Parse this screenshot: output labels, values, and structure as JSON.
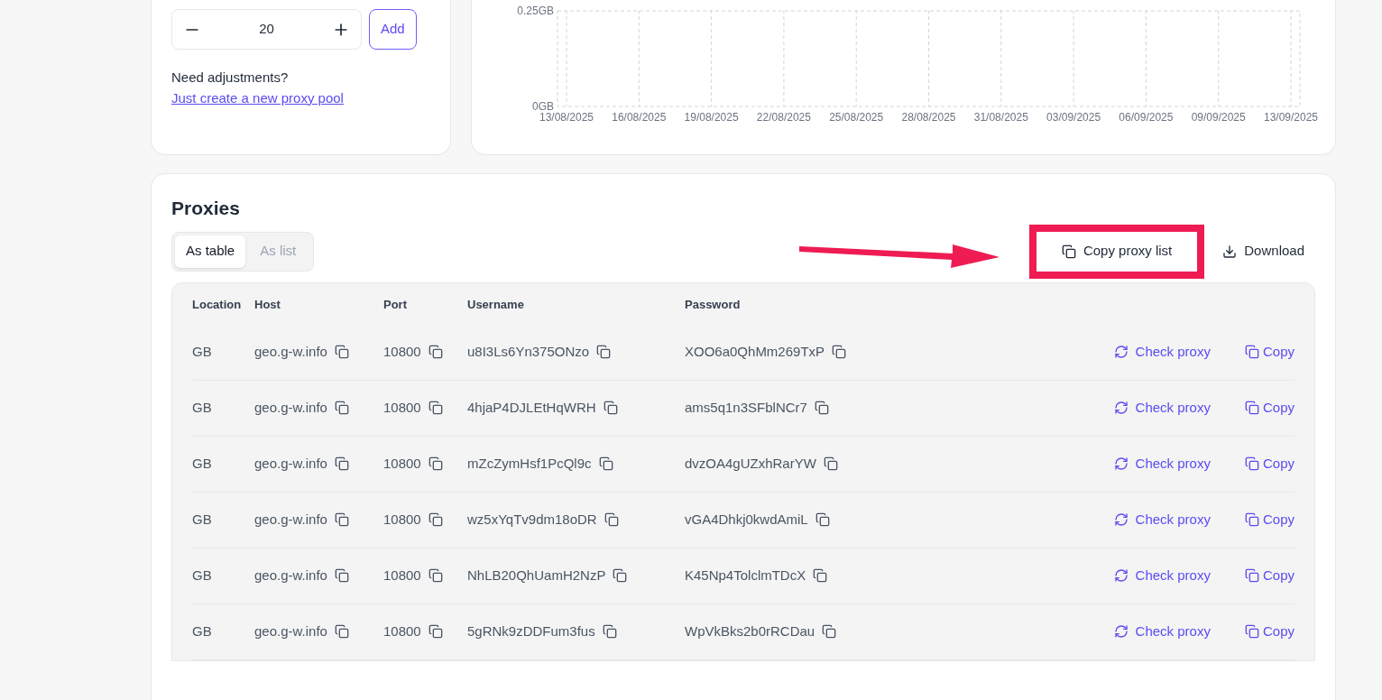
{
  "pool": {
    "quantity": "20",
    "add_button": "Add",
    "question": "Need adjustments?",
    "link": "Just create a new proxy pool"
  },
  "usage_chart": {
    "chart_data": {
      "type": "line",
      "categories": [
        "13/08/2025",
        "16/08/2025",
        "19/08/2025",
        "22/08/2025",
        "25/08/2025",
        "28/08/2025",
        "31/08/2025",
        "03/09/2025",
        "06/09/2025",
        "09/09/2025",
        "13/09/2025"
      ],
      "ylim": [
        0,
        0.25
      ],
      "grid": true,
      "yticks": [
        {
          "value": 0,
          "label": "0GB"
        },
        {
          "value": 0.25,
          "label": "0.25GB"
        }
      ]
    }
  },
  "proxies": {
    "title": "Proxies",
    "tabs": [
      {
        "label": "As table",
        "selected": true
      },
      {
        "label": "As list",
        "selected": false
      }
    ],
    "actions": [
      {
        "kind": "copy",
        "label": "Copy proxy list",
        "highlighted": true
      },
      {
        "kind": "download",
        "label": "Download",
        "highlighted": false
      }
    ],
    "columns": [
      "Location",
      "Host",
      "Port",
      "Username",
      "Password"
    ],
    "rows": [
      {
        "location": "GB",
        "host": "geo.g-w.info",
        "port": "10800",
        "username": "u8I3Ls6Yn375ONzo",
        "password": "XOO6a0QhMm269TxP",
        "check": "Check proxy",
        "copy": "Copy"
      },
      {
        "location": "GB",
        "host": "geo.g-w.info",
        "port": "10800",
        "username": "4hjaP4DJLEtHqWRH",
        "password": "ams5q1n3SFblNCr7",
        "check": "Check proxy",
        "copy": "Copy"
      },
      {
        "location": "GB",
        "host": "geo.g-w.info",
        "port": "10800",
        "username": "mZcZymHsf1PcQl9c",
        "password": "dvzOA4gUZxhRarYW",
        "check": "Check proxy",
        "copy": "Copy"
      },
      {
        "location": "GB",
        "host": "geo.g-w.info",
        "port": "10800",
        "username": "wz5xYqTv9dm18oDR",
        "password": "vGA4Dhkj0kwdAmiL",
        "check": "Check proxy",
        "copy": "Copy"
      },
      {
        "location": "GB",
        "host": "geo.g-w.info",
        "port": "10800",
        "username": "NhLB20QhUamH2NzP",
        "password": "K45Np4TolclmTDcX",
        "check": "Check proxy",
        "copy": "Copy"
      },
      {
        "location": "GB",
        "host": "geo.g-w.info",
        "port": "10800",
        "username": "5gRNk9zDDFum3fus",
        "password": "WpVkBks2b0rRCDau",
        "check": "Check proxy",
        "copy": "Copy"
      }
    ]
  }
}
